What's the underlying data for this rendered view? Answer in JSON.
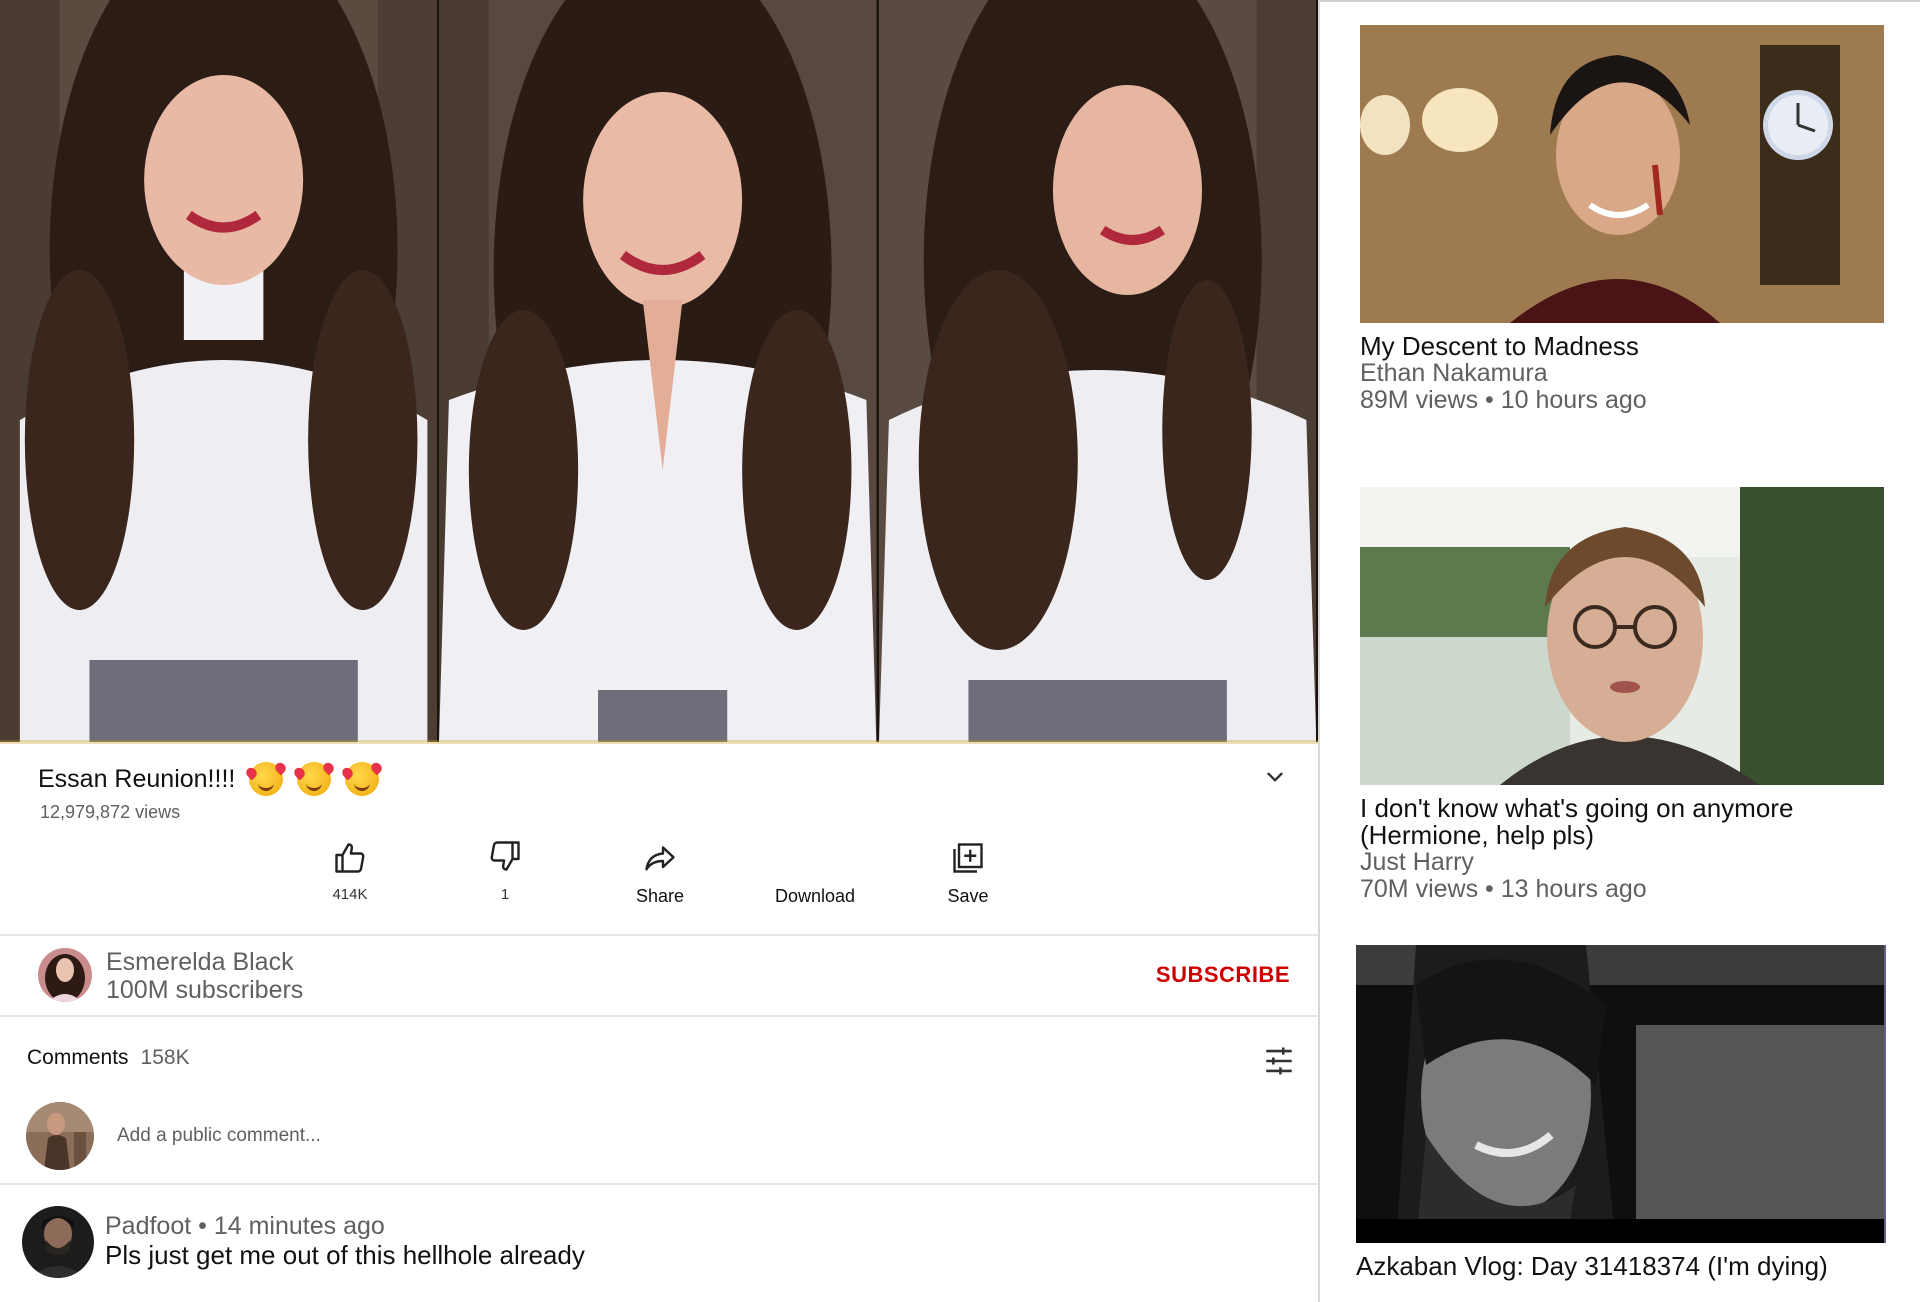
{
  "video": {
    "title": "Essan Reunion!!!!",
    "title_emoji": "smiling-face-with-hearts",
    "views": "12,979,872 views"
  },
  "actions": {
    "like_count": "414K",
    "dislike_count": "1",
    "share_label": "Share",
    "download_label": "Download",
    "save_label": "Save"
  },
  "channel": {
    "name": "Esmerelda Black",
    "subscribers": "100M subscribers",
    "subscribe_label": "SUBSCRIBE",
    "subscribe_color": "#cc0000"
  },
  "comments": {
    "heading": "Comments",
    "count": "158K",
    "placeholder": "Add a public comment...",
    "items": [
      {
        "author": "Padfoot",
        "time": "14 minutes ago",
        "text": "Pls just get me out of this hellhole already"
      }
    ]
  },
  "recommendations": [
    {
      "title": "My Descent to Madness",
      "channel": "Ethan Nakamura",
      "meta": "89M views • 10 hours ago"
    },
    {
      "title": "I don't know what's going on anymore (Hermione, help pls)",
      "channel": "Just Harry",
      "meta": "70M views • 13 hours ago"
    },
    {
      "title": "Azkaban Vlog: Day 31418374 (I'm dying)",
      "channel": "",
      "meta": ""
    }
  ],
  "icons": {
    "like": "thumbs-up-icon",
    "dislike": "thumbs-down-icon",
    "share": "share-arrow-icon",
    "save": "add-to-playlist-icon",
    "expand": "chevron-down-icon",
    "sort": "sort-sliders-icon"
  }
}
